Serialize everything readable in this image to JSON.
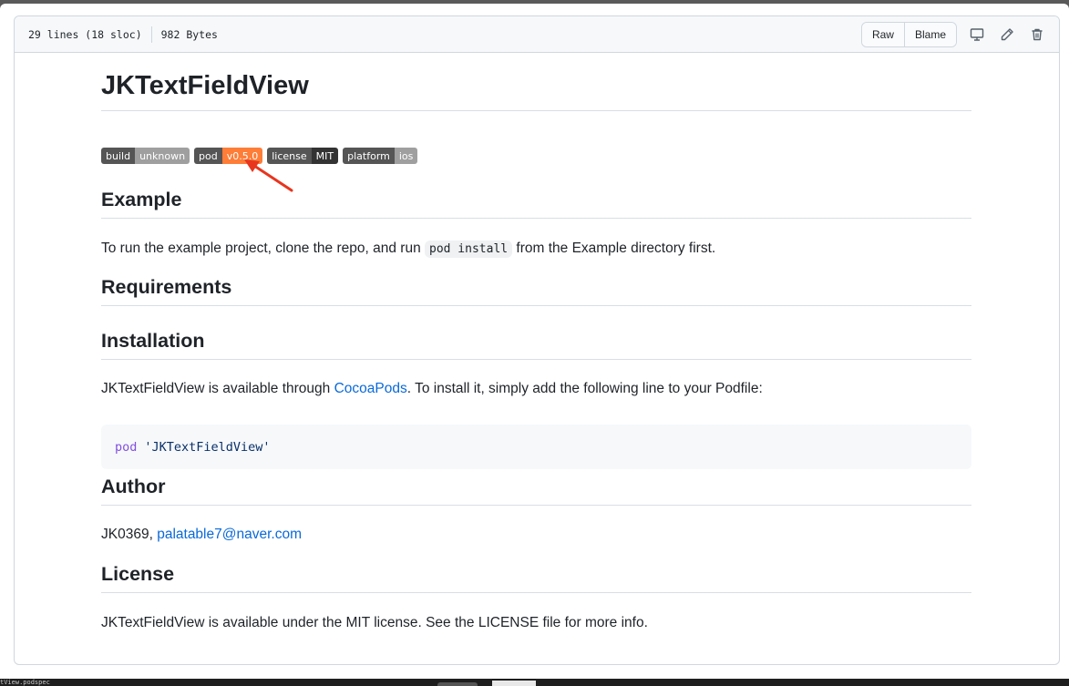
{
  "header": {
    "lines": "29 lines (18 sloc)",
    "size": "982 Bytes",
    "raw_label": "Raw",
    "blame_label": "Blame"
  },
  "readme": {
    "title": "JKTextFieldView",
    "badges": [
      {
        "left": "build",
        "right": "unknown",
        "color": "#9f9f9f"
      },
      {
        "left": "pod",
        "right": "v0.5.0",
        "color": "#fe7d37"
      },
      {
        "left": "license",
        "right": "MIT",
        "color": "#555555"
      },
      {
        "left": "platform",
        "right": "ios",
        "color": "#9f9f9f"
      }
    ],
    "example_heading": "Example",
    "example_text_before": "To run the example project, clone the repo, and run",
    "example_code": "pod install",
    "example_text_after": "from the Example directory first.",
    "requirements_heading": "Requirements",
    "installation_heading": "Installation",
    "installation_text_before": "JKTextFieldView is available through",
    "installation_link": "CocoaPods",
    "installation_text_after": ". To install it, simply add the following line to your Podfile:",
    "code_keyword": "pod",
    "code_string": "'JKTextFieldView'",
    "author_heading": "Author",
    "author_name": "JK0369,",
    "author_email": "palatable7@naver.com",
    "license_heading": "License",
    "license_text": "JKTextFieldView is available under the MIT license. See the LICENSE file for more info."
  },
  "taskbar": {
    "filename": "tView.podspec"
  },
  "colors": {
    "annotation_arrow": "#e8351e",
    "link": "#0969da"
  }
}
